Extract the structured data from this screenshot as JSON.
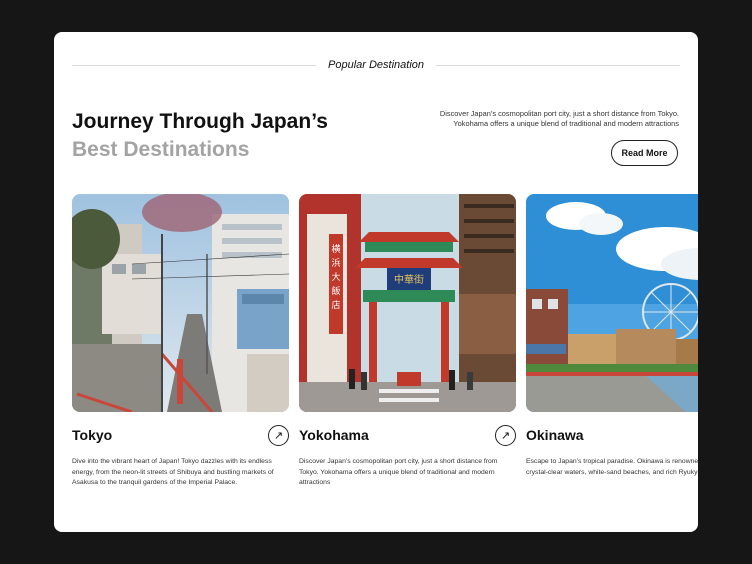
{
  "section": {
    "label": "Popular Destination"
  },
  "hero": {
    "title_line1": "Journey Through Japan’s",
    "title_line2": "Best Destinations",
    "intro": "Discover Japan’s cosmopolitan port city, just a short distance from Tokyo. Yokohama offers a unique blend of traditional and modern attractions",
    "read_more_label": "Read More"
  },
  "destinations": [
    {
      "name": "Tokyo",
      "description": "Dive into the vibrant heart of Japan! Tokyo dazzles with its endless energy, from the neon-lit streets of Shibuya and bustling markets of Asakusa to the tranquil gardens of the Imperial Palace.",
      "arrow_icon": "arrow-up-right-icon",
      "photo": "tokyo-street-photo"
    },
    {
      "name": "Yokohama",
      "description": "Discover Japan’s cosmopolitan port city, just a short distance from Tokyo. Yokohama offers a unique blend of traditional and modern attractions",
      "arrow_icon": "arrow-up-right-icon",
      "photo": "yokohama-chinatown-photo",
      "gate_sign": "中華街"
    },
    {
      "name": "Okinawa",
      "description": "Escape to Japan’s tropical paradise. Okinawa is renowned for its crystal-clear waters, white-sand beaches, and rich Ryukyu",
      "photo": "okinawa-waterfront-photo"
    }
  ],
  "colors": {
    "background": "#161616",
    "card": "#ffffff",
    "muted_title": "#a3a3a3",
    "text": "#111111"
  }
}
